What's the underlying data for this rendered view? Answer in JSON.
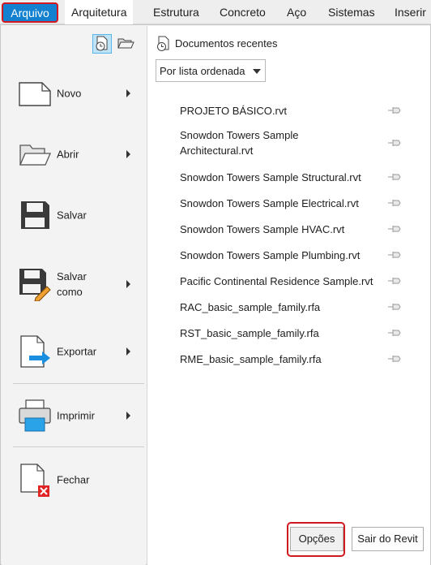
{
  "ribbon": {
    "tabs": [
      {
        "label": "Arquivo"
      },
      {
        "label": "Arquitetura"
      },
      {
        "label": "Estrutura"
      },
      {
        "label": "Concreto"
      },
      {
        "label": "Aço"
      },
      {
        "label": "Sistemas"
      },
      {
        "label": "Inserir"
      }
    ]
  },
  "menu": {
    "view_icons": [
      "recent-documents-icon",
      "open-documents-icon"
    ],
    "items": [
      {
        "label": "Novo",
        "icon": "new-file-icon",
        "has_submenu": true
      },
      {
        "label": "Abrir",
        "icon": "folder-open-icon",
        "has_submenu": true
      },
      {
        "label": "Salvar",
        "icon": "save-icon",
        "has_submenu": false
      },
      {
        "label": "Salvar\ncomo",
        "icon": "save-as-icon",
        "has_submenu": true
      },
      {
        "label": "Exportar",
        "icon": "export-icon",
        "has_submenu": true
      },
      {
        "label": "Imprimir",
        "icon": "printer-icon",
        "has_submenu": true
      },
      {
        "label": "Fechar",
        "icon": "close-file-icon",
        "has_submenu": false
      }
    ]
  },
  "recent": {
    "title": "Documentos recentes",
    "sort_selected": "Por lista ordenada",
    "files": [
      {
        "name": "PROJETO BÁSICO.rvt"
      },
      {
        "name": "Snowdon Towers Sample Architectural.rvt"
      },
      {
        "name": "Snowdon Towers Sample Structural.rvt"
      },
      {
        "name": "Snowdon Towers Sample Electrical.rvt"
      },
      {
        "name": "Snowdon Towers Sample HVAC.rvt"
      },
      {
        "name": "Snowdon Towers Sample Plumbing.rvt"
      },
      {
        "name": "Pacific Continental Residence Sample.rvt"
      },
      {
        "name": "RAC_basic_sample_family.rfa"
      },
      {
        "name": "RST_basic_sample_family.rfa"
      },
      {
        "name": "RME_basic_sample_family.rfa"
      }
    ]
  },
  "footer": {
    "options_label": "Opções",
    "exit_label": "Sair do Revit"
  },
  "colors": {
    "accent": "#1380d0",
    "highlight_frame": "#d11922"
  }
}
